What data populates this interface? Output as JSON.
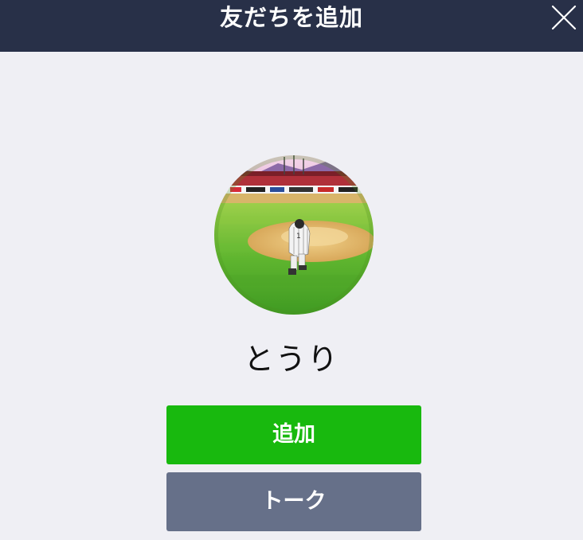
{
  "header": {
    "title": "友だちを追加",
    "close_icon": "close-icon"
  },
  "profile": {
    "avatar_icon": "profile-photo-baseball-player",
    "name": "とうり"
  },
  "actions": {
    "add_label": "追加",
    "talk_label": "トーク"
  },
  "colors": {
    "header_bg": "#283048",
    "page_bg": "#efeff4",
    "add_button": "#18b90e",
    "talk_button": "#667089"
  }
}
